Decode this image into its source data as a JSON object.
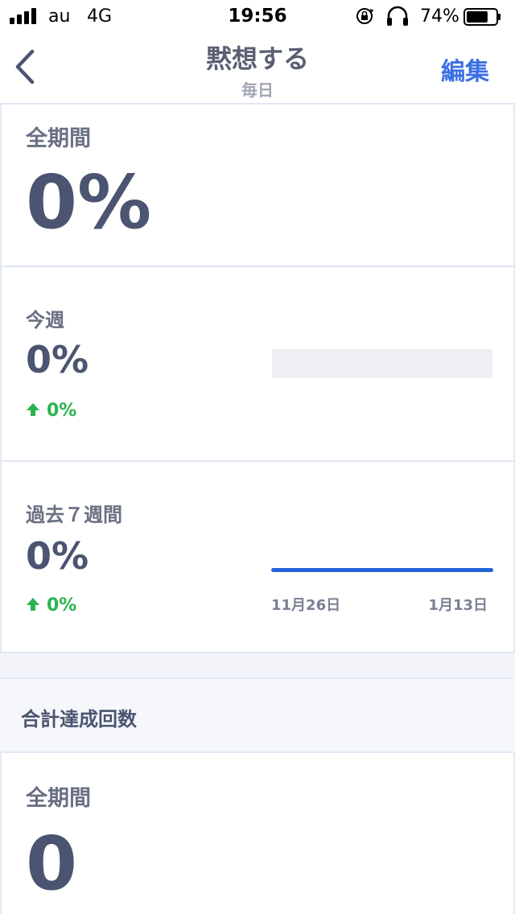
{
  "status": {
    "carrier": "au",
    "network": "4G",
    "time": "19:56",
    "battery_percent": "74%",
    "battery_level": 0.74,
    "icons": [
      "signal-icon",
      "orientation-lock-icon",
      "headphones-icon",
      "battery-icon"
    ]
  },
  "nav": {
    "back_icon": "chevron-left-icon",
    "title": "黙想する",
    "subtitle": "毎日",
    "edit_label": "編集"
  },
  "all_time": {
    "label": "全期間",
    "value": "0%"
  },
  "this_week": {
    "label": "今週",
    "value": "0%",
    "delta": "0%"
  },
  "past_7_weeks": {
    "label": "過去７週間",
    "value": "0%",
    "delta": "0%",
    "axis_start": "11月26日",
    "axis_end": "1月13日"
  },
  "total": {
    "section_title": "合計達成回数",
    "label": "全期間",
    "value": "0"
  },
  "colors": {
    "accent": "#3a6fe4",
    "positive": "#2bb34f",
    "line": "#2563d9"
  }
}
